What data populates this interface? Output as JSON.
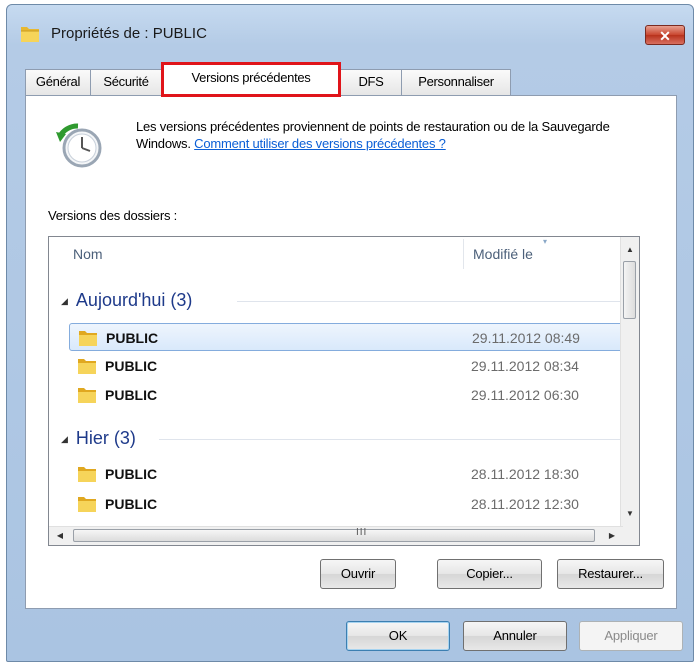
{
  "window": {
    "title": "Propriétés de : PUBLIC",
    "close_label": "✕"
  },
  "tabs": [
    {
      "label": "Général"
    },
    {
      "label": "Sécurité"
    },
    {
      "label": "Versions précédentes",
      "active": true
    },
    {
      "label": "DFS"
    },
    {
      "label": "Personnaliser"
    }
  ],
  "info": {
    "text": "Les versions précédentes proviennent de points de restauration ou de la Sauvegarde Windows.",
    "link": "Comment utiliser des versions précédentes ?"
  },
  "section_label": "Versions des dossiers :",
  "listview": {
    "columns": [
      "Nom",
      "Modifié le"
    ],
    "groups": [
      {
        "label": "Aujourd'hui (3)",
        "items": [
          {
            "name": "PUBLIC",
            "date": "29.11.2012 08:49",
            "selected": true
          },
          {
            "name": "PUBLIC",
            "date": "29.11.2012 08:34"
          },
          {
            "name": "PUBLIC",
            "date": "29.11.2012 06:30"
          }
        ]
      },
      {
        "label": "Hier (3)",
        "items": [
          {
            "name": "PUBLIC",
            "date": "28.11.2012 18:30"
          },
          {
            "name": "PUBLIC",
            "date": "28.11.2012 12:30"
          }
        ]
      }
    ],
    "hscroll_grip": "III"
  },
  "actions": {
    "open": "Ouvrir",
    "copy": "Copier...",
    "restore": "Restaurer..."
  },
  "footer": {
    "ok": "OK",
    "cancel": "Annuler",
    "apply": "Appliquer"
  },
  "colors": {
    "highlight_box": "#e0141a",
    "link": "#0b5fd6",
    "group_header": "#1e3a8a"
  },
  "icons": [
    "folder-icon",
    "restore-clock-icon",
    "close-icon",
    "scroll-up-icon",
    "scroll-down-icon",
    "scroll-left-icon",
    "scroll-right-icon"
  ]
}
